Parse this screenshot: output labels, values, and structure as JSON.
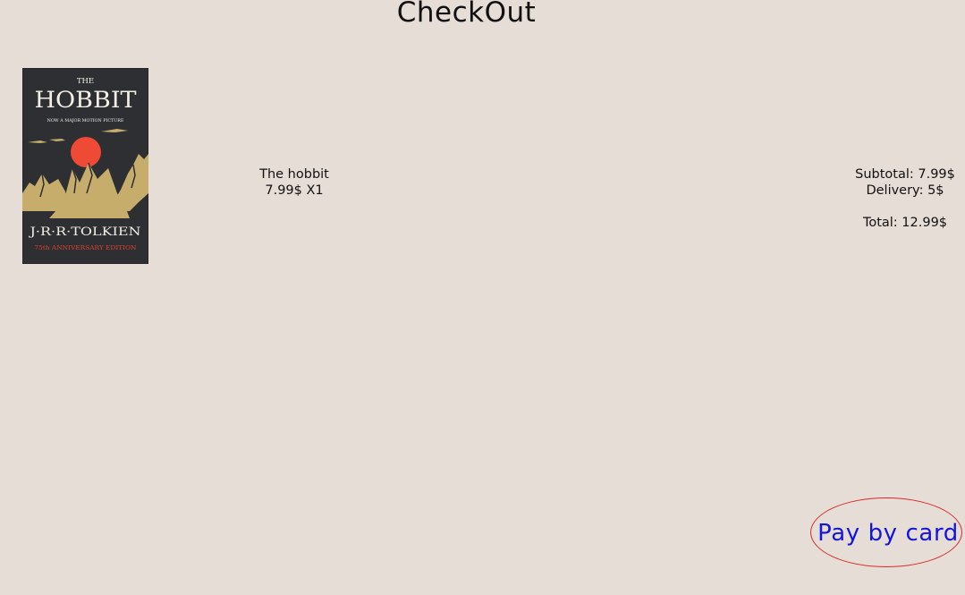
{
  "header": {
    "title": "CheckOut"
  },
  "cart": {
    "items": [
      {
        "name": "The hobbit",
        "price_qty": "7.99$ X1",
        "cover": {
          "title_top": "THE",
          "title_main": "HOBBIT",
          "tagline": "NOW A MAJOR MOTION PICTURE",
          "author": "J·R·R·TOLKIEN",
          "edition": "75th ANNIVERSARY EDITION",
          "colors": {
            "background": "#2d2f33",
            "sun": "#ef4a36",
            "mountains": "#c6ad6c",
            "text": "#f4efe4",
            "edition_text": "#e0412e"
          }
        }
      }
    ]
  },
  "summary": {
    "subtotal": "Subtotal: 7.99$",
    "delivery": "Delivery: 5$",
    "total": "Total: 12.99$"
  },
  "actions": {
    "pay_label": "Pay by card",
    "pay_text_color": "#1414e0",
    "pay_border_color": "#d92a2a"
  }
}
